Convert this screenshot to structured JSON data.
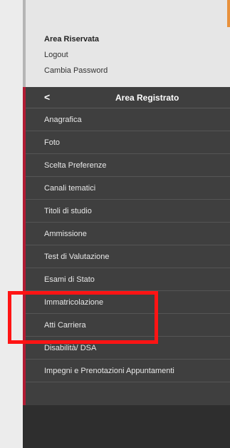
{
  "user_panel": {
    "title": "Area Riservata",
    "logout": "Logout",
    "change_password": "Cambia Password"
  },
  "nav": {
    "back_glyph": "<",
    "header_title": "Area Registrato",
    "items": [
      {
        "label": "Anagrafica"
      },
      {
        "label": "Foto"
      },
      {
        "label": "Scelta Preferenze"
      },
      {
        "label": "Canali tematici"
      },
      {
        "label": "Titoli di studio"
      },
      {
        "label": "Ammissione"
      },
      {
        "label": "Test di Valutazione"
      },
      {
        "label": "Esami di Stato"
      },
      {
        "label": "Immatricolazione"
      },
      {
        "label": "Atti Carriera"
      },
      {
        "label": "Disabilità/ DSA"
      },
      {
        "label": "Impegni e Prenotazioni Appuntamenti"
      }
    ]
  },
  "colors": {
    "nav_background": "#3f3f3f",
    "accent_red": "#b11b33",
    "highlight_red": "#ff1414",
    "panel_grey": "#e6e6e6",
    "orange_tab": "#e8913c"
  }
}
